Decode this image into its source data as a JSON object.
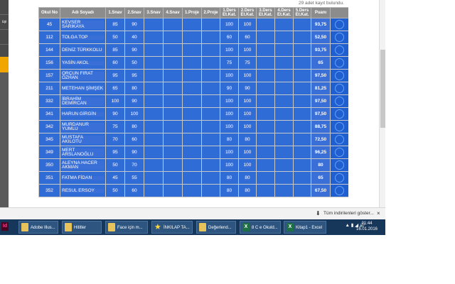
{
  "record_count": "29 adet kayıt bulundu.",
  "left_items": [
    "üşi"
  ],
  "columns": [
    "Okul No",
    "Adı Soyadı",
    "1.Snav",
    "2.Snav",
    "3.Snav",
    "4.Snav",
    "1.Proje",
    "2.Proje",
    "1.Ders Et.Kat.",
    "2.Ders Et.Kat.",
    "3.Ders Et.Kat.",
    "4.Ders Et.Kat.",
    "5.Ders Et.Kat.",
    "Puanı",
    ""
  ],
  "rows": [
    {
      "no": "45",
      "name": "KEVSER SARIKAYA",
      "s1": "85",
      "s2": "90",
      "d1": "100",
      "d2": "100",
      "puan": "93,75"
    },
    {
      "no": "112",
      "name": "TOLGA TOP",
      "s1": "50",
      "s2": "40",
      "d1": "60",
      "d2": "60",
      "puan": "52,50"
    },
    {
      "no": "144",
      "name": "DENİZ TÜRKKOLU",
      "s1": "85",
      "s2": "90",
      "d1": "100",
      "d2": "100",
      "puan": "93,75"
    },
    {
      "no": "156",
      "name": "YASİN AKOL",
      "s1": "60",
      "s2": "50",
      "d1": "75",
      "d2": "75",
      "puan": "65"
    },
    {
      "no": "157",
      "name": "ORÇUN FIRAT ÖZHAN",
      "s1": "95",
      "s2": "95",
      "d1": "100",
      "d2": "100",
      "puan": "97,50"
    },
    {
      "no": "211",
      "name": "METEHAN ŞİMŞEK",
      "s1": "65",
      "s2": "80",
      "d1": "90",
      "d2": "90",
      "puan": "81,25"
    },
    {
      "no": "332",
      "name": "İBRAHİM DEMİRCAN",
      "s1": "100",
      "s2": "90",
      "d1": "100",
      "d2": "100",
      "puan": "97,50"
    },
    {
      "no": "341",
      "name": "HARUN GİRGİN",
      "s1": "90",
      "s2": "100",
      "d1": "100",
      "d2": "100",
      "puan": "97,50"
    },
    {
      "no": "342",
      "name": "MURDANUR YUMLU",
      "s1": "75",
      "s2": "80",
      "d1": "100",
      "d2": "100",
      "puan": "88,75"
    },
    {
      "no": "345",
      "name": "MUSTAFA AKILOTU",
      "s1": "70",
      "s2": "60",
      "d1": "80",
      "d2": "80",
      "puan": "72,50"
    },
    {
      "no": "349",
      "name": "MERT ARSLANOĞLU",
      "s1": "95",
      "s2": "90",
      "d1": "100",
      "d2": "100",
      "puan": "96,25"
    },
    {
      "no": "350",
      "name": "ALEYNA HACER AKMAN",
      "s1": "50",
      "s2": "70",
      "d1": "100",
      "d2": "100",
      "puan": "80"
    },
    {
      "no": "351",
      "name": "FATMA FİDAN",
      "s1": "45",
      "s2": "55",
      "d1": "80",
      "d2": "80",
      "puan": "65"
    },
    {
      "no": "352",
      "name": "RESUL ERSOY",
      "s1": "50",
      "s2": "60",
      "d1": "80",
      "d2": "80",
      "puan": "67,50"
    }
  ],
  "download_bar": {
    "arrow": "⬇",
    "link": "Tüm indirilenleri göster...",
    "close": "×"
  },
  "taskbar": {
    "items": [
      {
        "label": "Adobe Illus...",
        "icon": "folder"
      },
      {
        "label": "Hititler",
        "icon": "folder"
      },
      {
        "label": "Face için m...",
        "icon": "folder"
      },
      {
        "label": "İNKILAP TA...",
        "icon": "star"
      },
      {
        "label": "Değerlend...",
        "icon": "folder"
      },
      {
        "label": "8 C e Okuld...",
        "icon": "excel"
      },
      {
        "label": "Kitap1 - Excel",
        "icon": "excel"
      }
    ],
    "app_icon": "Id",
    "excel_letter": "X",
    "time": "21:44",
    "date": "16.01.2016",
    "tray": "▲  ▮  ◢  🔊"
  }
}
